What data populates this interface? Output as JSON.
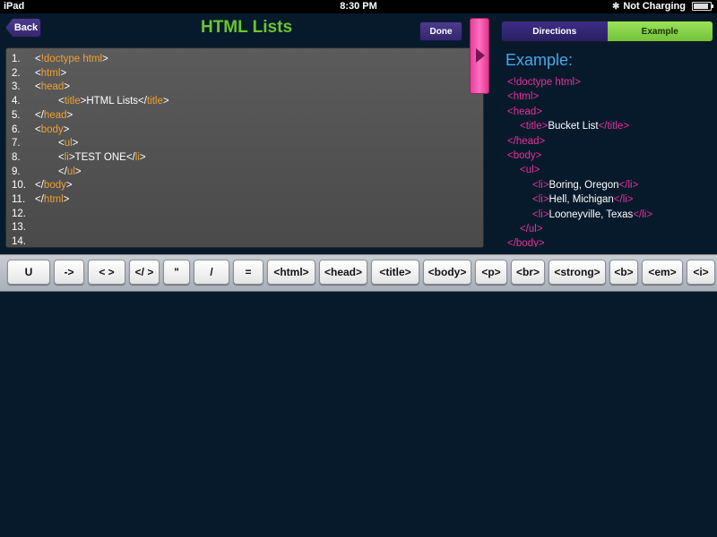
{
  "status_bar": {
    "device": "iPad",
    "time": "8:30 PM",
    "battery_text": "Not Charging",
    "battery_level": 0.9
  },
  "header": {
    "back_label": "Back",
    "title": "HTML Lists",
    "done_label": "Done"
  },
  "editor": {
    "lines": [
      {
        "num": "1.",
        "indent": 0,
        "parts": [
          [
            "t",
            "<"
          ],
          [
            "g",
            "!doctype html"
          ],
          [
            "t",
            ">"
          ]
        ]
      },
      {
        "num": "2.",
        "indent": 0,
        "parts": [
          [
            "t",
            "<"
          ],
          [
            "g",
            "html"
          ],
          [
            "t",
            ">"
          ]
        ]
      },
      {
        "num": "3.",
        "indent": 0,
        "parts": [
          [
            "t",
            "<"
          ],
          [
            "g",
            "head"
          ],
          [
            "t",
            ">"
          ]
        ]
      },
      {
        "num": "4.",
        "indent": 1,
        "parts": [
          [
            "t",
            "<"
          ],
          [
            "g",
            "title"
          ],
          [
            "t",
            ">HTML Lists</"
          ],
          [
            "g",
            "title"
          ],
          [
            "t",
            ">"
          ]
        ]
      },
      {
        "num": "5.",
        "indent": 0,
        "parts": [
          [
            "t",
            "</"
          ],
          [
            "g",
            "head"
          ],
          [
            "t",
            ">"
          ]
        ]
      },
      {
        "num": "6.",
        "indent": 0,
        "parts": [
          [
            "t",
            "<"
          ],
          [
            "g",
            "body"
          ],
          [
            "t",
            ">"
          ]
        ]
      },
      {
        "num": "7.",
        "indent": 1,
        "parts": [
          [
            "t",
            "<"
          ],
          [
            "g",
            "ul"
          ],
          [
            "t",
            ">"
          ]
        ]
      },
      {
        "num": "8.",
        "indent": 1,
        "parts": [
          [
            "t",
            "<"
          ],
          [
            "g",
            "li"
          ],
          [
            "t",
            ">TEST ONE</"
          ],
          [
            "g",
            "li"
          ],
          [
            "t",
            ">"
          ]
        ]
      },
      {
        "num": "9.",
        "indent": 1,
        "parts": [
          [
            "t",
            "</"
          ],
          [
            "g",
            "ul"
          ],
          [
            "t",
            ">"
          ]
        ]
      },
      {
        "num": "10.",
        "indent": 0,
        "parts": [
          [
            "t",
            "</"
          ],
          [
            "g",
            "body"
          ],
          [
            "t",
            ">"
          ]
        ]
      },
      {
        "num": "11.",
        "indent": 0,
        "parts": [
          [
            "t",
            "</"
          ],
          [
            "g",
            "html"
          ],
          [
            "t",
            ">"
          ]
        ]
      },
      {
        "num": "12.",
        "indent": 0,
        "parts": []
      },
      {
        "num": "13.",
        "indent": 0,
        "parts": []
      },
      {
        "num": "14.",
        "indent": 0,
        "parts": []
      }
    ]
  },
  "right_panel": {
    "tabs": [
      {
        "label": "Directions",
        "selected": false
      },
      {
        "label": "Example",
        "selected": true
      }
    ],
    "example_title": "Example:",
    "example_lines": [
      {
        "indent": 0,
        "parts": [
          [
            "g",
            "<!doctype html>"
          ]
        ]
      },
      {
        "indent": 0,
        "parts": [
          [
            "g",
            "<html>"
          ]
        ]
      },
      {
        "indent": 0,
        "parts": [
          [
            "g",
            "<head>"
          ]
        ]
      },
      {
        "indent": 1,
        "parts": [
          [
            "g",
            "<title>"
          ],
          [
            "t",
            "Bucket List"
          ],
          [
            "g",
            "</title>"
          ]
        ]
      },
      {
        "indent": 0,
        "parts": [
          [
            "g",
            "</head>"
          ]
        ]
      },
      {
        "indent": 0,
        "parts": [
          [
            "g",
            "<body>"
          ]
        ]
      },
      {
        "indent": 1,
        "parts": [
          [
            "g",
            "<ul>"
          ]
        ]
      },
      {
        "indent": 2,
        "parts": [
          [
            "g",
            "<li>"
          ],
          [
            "t",
            "Boring, Oregon"
          ],
          [
            "g",
            "</li>"
          ]
        ]
      },
      {
        "indent": 2,
        "parts": [
          [
            "g",
            "<li>"
          ],
          [
            "t",
            "Hell, Michigan"
          ],
          [
            "g",
            "</li>"
          ]
        ]
      },
      {
        "indent": 2,
        "parts": [
          [
            "g",
            "<li>"
          ],
          [
            "t",
            "Looneyville, Texas"
          ],
          [
            "g",
            "</li>"
          ]
        ]
      },
      {
        "indent": 1,
        "parts": [
          [
            "g",
            "</ul>"
          ]
        ]
      },
      {
        "indent": 0,
        "parts": [
          [
            "g",
            "</body>"
          ]
        ]
      }
    ]
  },
  "keys": [
    "U",
    "->",
    "< >",
    "</ >",
    "\"",
    "/",
    "=",
    "<html>",
    "<head>",
    "<title>",
    "<body>",
    "<p>",
    "<br>",
    "<strong>",
    "<b>",
    "<em>",
    "<i>"
  ]
}
